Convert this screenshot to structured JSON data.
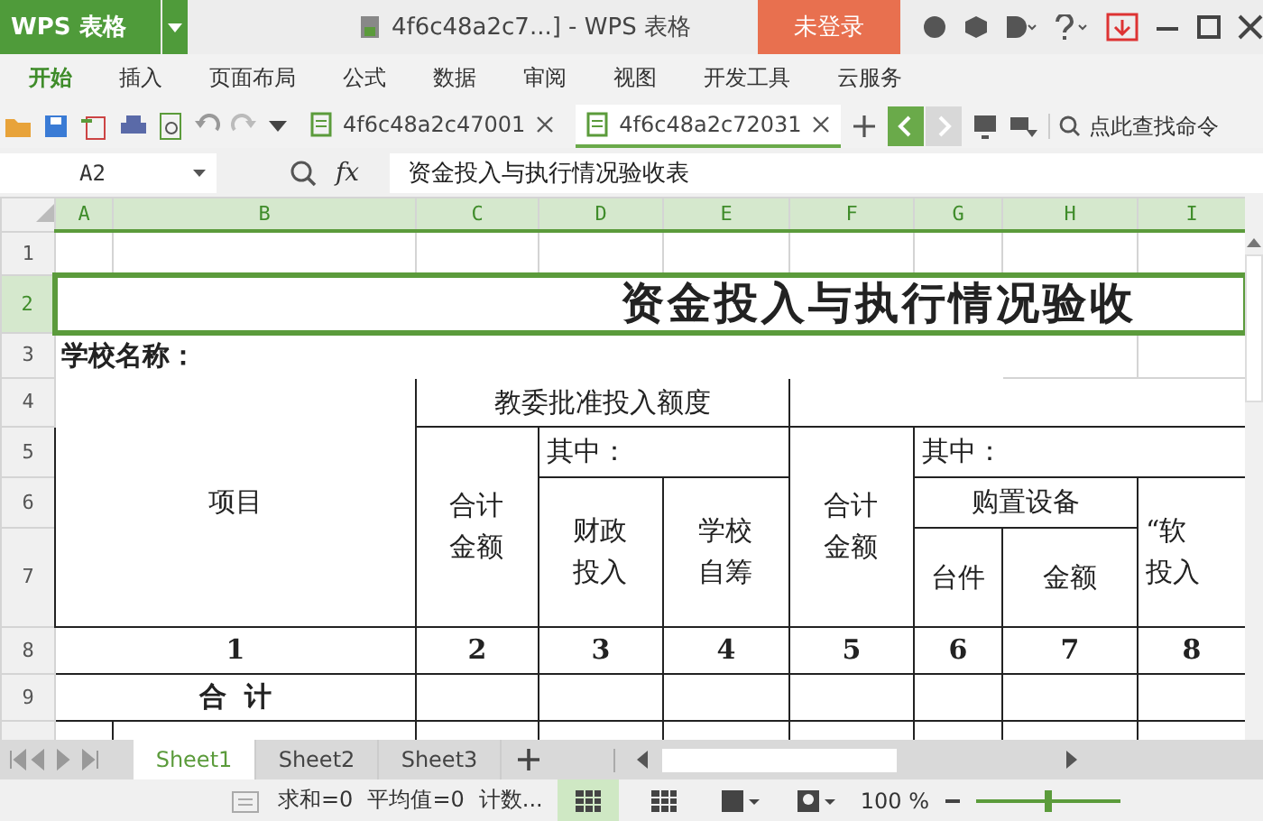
{
  "title_bar": {
    "app": "WPS 表格",
    "doc_title": "4f6c48a2c7...] - WPS 表格",
    "login": "未登录"
  },
  "menu": [
    {
      "label": "开始",
      "selected": true
    },
    {
      "label": "插入",
      "selected": false
    },
    {
      "label": "页面布局",
      "selected": false
    },
    {
      "label": "公式",
      "selected": false
    },
    {
      "label": "数据",
      "selected": false
    },
    {
      "label": "审阅",
      "selected": false
    },
    {
      "label": "视图",
      "selected": false
    },
    {
      "label": "开发工具",
      "selected": false
    },
    {
      "label": "云服务",
      "selected": false
    }
  ],
  "doc_tabs": [
    {
      "label": "4f6c48a2c47001",
      "selected": false
    },
    {
      "label": "4f6c48a2c72031",
      "selected": true
    }
  ],
  "search": {
    "placeholder": "点此查找命令"
  },
  "formula_bar": {
    "name_box": "A2",
    "fx": "fx",
    "formula": "资金投入与执行情况验收表"
  },
  "sheet": {
    "columns": [
      {
        "label": "A",
        "selected": true
      },
      {
        "label": "B",
        "selected": true
      },
      {
        "label": "C",
        "selected": true
      },
      {
        "label": "D",
        "selected": true
      },
      {
        "label": "E",
        "selected": true
      },
      {
        "label": "F",
        "selected": true
      },
      {
        "label": "G",
        "selected": true
      },
      {
        "label": "H",
        "selected": true
      },
      {
        "label": "I",
        "selected": true
      }
    ],
    "rows": [
      {
        "header": "1",
        "selected": false,
        "cells": [
          {
            "kind": "empty"
          },
          {
            "kind": "empty"
          },
          {
            "kind": "empty"
          },
          {
            "kind": "empty"
          },
          {
            "kind": "empty"
          },
          {
            "kind": "empty"
          },
          {
            "kind": "empty"
          },
          {
            "kind": "empty"
          },
          {
            "kind": "empty"
          }
        ]
      },
      {
        "header": "2",
        "selected": true,
        "cells": [
          {
            "kind": "title",
            "text": "资金投入与执行情况验收",
            "colspan": 9
          }
        ]
      },
      {
        "header": "3",
        "selected": false,
        "cells": [
          {
            "kind": "label",
            "text": "学校名称：",
            "colspan": 7
          },
          {
            "kind": "empty"
          },
          {
            "kind": "empty"
          }
        ]
      },
      {
        "header": "4",
        "selected": false,
        "cells": [
          {
            "kind": "header",
            "text": "项目",
            "colspan": 2,
            "rowspan": 4
          },
          {
            "kind": "header",
            "text": "教委批准投入额度",
            "colspan": 3
          },
          {
            "kind": "form",
            "colspan": 4
          }
        ]
      },
      {
        "header": "5",
        "selected": false,
        "cells": [
          {
            "kind": "stacked",
            "text": "合计金额",
            "rowspan": 3
          },
          {
            "kind": "subheader",
            "text": "其中：",
            "colspan": 2
          },
          {
            "kind": "stacked",
            "text": "合计金额",
            "rowspan": 3
          },
          {
            "kind": "subheader",
            "text": "其中：",
            "colspan": 3
          }
        ]
      },
      {
        "header": "6",
        "selected": false,
        "cells": [
          {
            "kind": "stacked",
            "text": "财政投入",
            "rowspan": 2
          },
          {
            "kind": "stacked",
            "text": "学校自筹",
            "rowspan": 2
          },
          {
            "kind": "header",
            "text": "购置设备",
            "colspan": 2
          },
          {
            "kind": "stacked-left",
            "text": "“软投入",
            "rowspan": 2
          }
        ]
      },
      {
        "header": "7",
        "selected": false,
        "cells": [
          {
            "kind": "header",
            "text": "台件"
          },
          {
            "kind": "header",
            "text": "金额"
          }
        ]
      },
      {
        "header": "8",
        "selected": false,
        "cells": [
          {
            "kind": "number",
            "text": "1",
            "colspan": 2
          },
          {
            "kind": "number",
            "text": "2"
          },
          {
            "kind": "number",
            "text": "3"
          },
          {
            "kind": "number",
            "text": "4"
          },
          {
            "kind": "number",
            "text": "5"
          },
          {
            "kind": "number",
            "text": "6"
          },
          {
            "kind": "number",
            "text": "7"
          },
          {
            "kind": "number",
            "text": "8"
          }
        ]
      },
      {
        "header": "9",
        "selected": false,
        "cells": [
          {
            "kind": "total",
            "text": "合  计",
            "colspan": 2
          },
          {
            "kind": "form"
          },
          {
            "kind": "form"
          },
          {
            "kind": "form"
          },
          {
            "kind": "form"
          },
          {
            "kind": "form"
          },
          {
            "kind": "form"
          },
          {
            "kind": "form"
          }
        ]
      },
      {
        "selected": false,
        "cells": [
          {
            "kind": "form"
          },
          {
            "kind": "form"
          },
          {
            "kind": "form"
          },
          {
            "kind": "form"
          },
          {
            "kind": "form"
          },
          {
            "kind": "form"
          },
          {
            "kind": "form"
          },
          {
            "kind": "form"
          },
          {
            "kind": "form"
          }
        ]
      }
    ]
  },
  "sheet_tabs": [
    {
      "label": "Sheet1",
      "selected": true
    },
    {
      "label": "Sheet2",
      "selected": false
    },
    {
      "label": "Sheet3",
      "selected": false
    }
  ],
  "status_bar": {
    "sum": "求和=0",
    "average": "平均值=0",
    "count": "计数...",
    "zoom": "100 %",
    "zoom_slider": {
      "level": 0.5
    }
  }
}
